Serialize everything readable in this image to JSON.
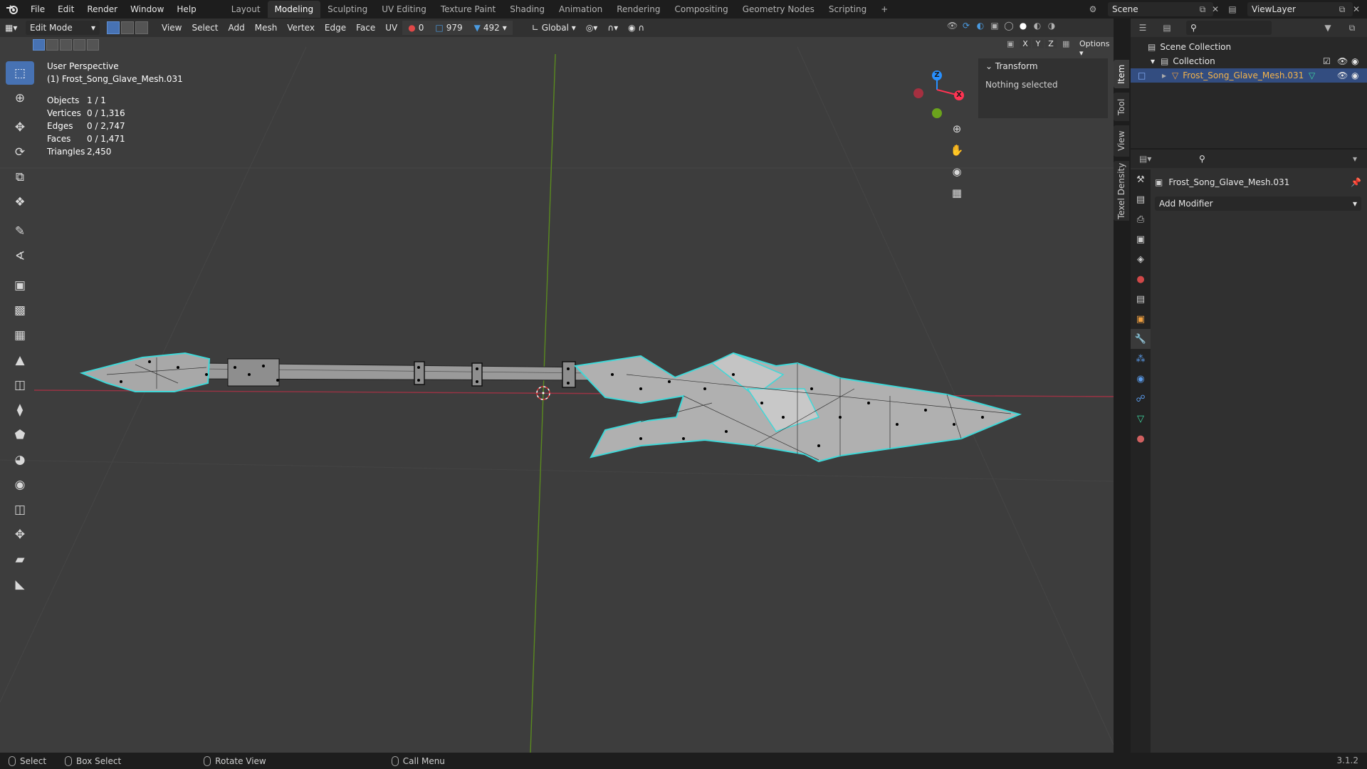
{
  "app": {
    "menus": [
      "File",
      "Edit",
      "Render",
      "Window",
      "Help"
    ],
    "workspaces": [
      "Layout",
      "Modeling",
      "Sculpting",
      "UV Editing",
      "Texture Paint",
      "Shading",
      "Animation",
      "Rendering",
      "Compositing",
      "Geometry Nodes",
      "Scripting"
    ],
    "active_workspace": "Modeling",
    "add_workspace": "+",
    "scene": "Scene",
    "view_layer": "ViewLayer",
    "version": "3.1.2"
  },
  "viewport_header": {
    "mode": "Edit Mode",
    "menus": [
      "View",
      "Select",
      "Add",
      "Mesh",
      "Vertex",
      "Edge",
      "Face",
      "UV"
    ],
    "stat_a": "0",
    "stat_b": "979",
    "stat_c": "492",
    "transform_orientation": "Global",
    "axes": [
      "X",
      "Y",
      "Z"
    ],
    "options": "Options"
  },
  "overlay": {
    "perspective": "User Perspective",
    "object_label": "(1) Frost_Song_Glave_Mesh.031",
    "stats": [
      {
        "label": "Objects",
        "value": "1 / 1"
      },
      {
        "label": "Vertices",
        "value": "0 / 1,316"
      },
      {
        "label": "Edges",
        "value": "0 / 2,747"
      },
      {
        "label": "Faces",
        "value": "0 / 1,471"
      },
      {
        "label": "Triangles",
        "value": "2,450"
      }
    ]
  },
  "gizmo": {
    "z": "Z",
    "x": "X"
  },
  "npanel": {
    "section": "Transform",
    "message": "Nothing selected",
    "tabs": [
      "Item",
      "Tool",
      "View",
      "Texel Density"
    ]
  },
  "outliner": {
    "scene_collection": "Scene Collection",
    "collection": "Collection",
    "object": "Frost_Song_Glave_Mesh.031"
  },
  "properties": {
    "object_name": "Frost_Song_Glave_Mesh.031",
    "add_modifier": "Add Modifier"
  },
  "statusbar": {
    "select": "Select",
    "box_select": "Box Select",
    "rotate_view": "Rotate View",
    "call_menu": "Call Menu"
  },
  "colors": {
    "accent": "#4772b3",
    "selected_edge": "#3fd8d8",
    "x_axis": "#ff3352",
    "y_axis": "#8bdc00",
    "z_axis": "#2890ff"
  }
}
